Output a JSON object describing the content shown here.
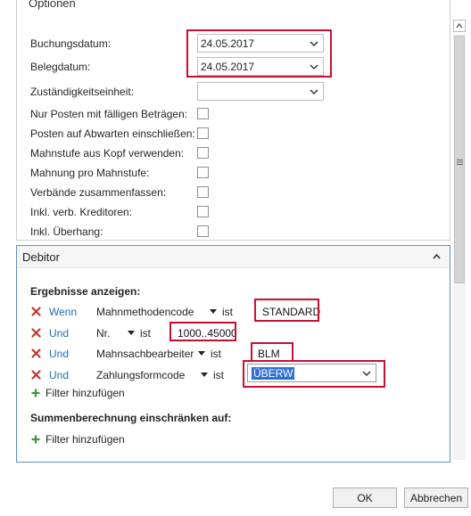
{
  "options": {
    "title": "Optionen",
    "posting_date": {
      "label": "Buchungsdatum:",
      "value": "24.05.2017"
    },
    "document_date": {
      "label": "Belegdatum:",
      "value": "24.05.2017"
    },
    "responsibility_center": {
      "label": "Zuständigkeitseinheit:",
      "value": ""
    },
    "checkboxes": [
      {
        "label": "Nur Posten mit fälligen Beträgen:",
        "checked": false
      },
      {
        "label": "Posten auf Abwarten einschließen:",
        "checked": false
      },
      {
        "label": "Mahnstufe aus Kopf verwenden:",
        "checked": false
      },
      {
        "label": "Mahnung pro Mahnstufe:",
        "checked": false
      },
      {
        "label": "Verbände zusammenfassen:",
        "checked": false
      },
      {
        "label": "Inkl. verb. Kreditoren:",
        "checked": false
      },
      {
        "label": "Inkl. Überhang:",
        "checked": false
      }
    ]
  },
  "debitor": {
    "title": "Debitor",
    "results_heading": "Ergebnisse anzeigen:",
    "filters": [
      {
        "connector": "Wenn",
        "field": "Mahnmethodencode",
        "operator": "ist",
        "value": "STANDARD"
      },
      {
        "connector": "Und",
        "field": "Nr.",
        "operator": "ist",
        "value": "1000..45000"
      },
      {
        "connector": "Und",
        "field": "Mahnsachbearbeiter",
        "operator": "ist",
        "value": "BLM"
      },
      {
        "connector": "Und",
        "field": "Zahlungsformcode",
        "operator": "ist",
        "value": "ÜBERW"
      }
    ],
    "add_filter_label": "Filter hinzufügen",
    "sum_heading": "Summenberechnung einschränken auf:",
    "sum_add_filter_label": "Filter hinzufügen"
  },
  "buttons": {
    "ok": "OK",
    "cancel": "Abbrechen"
  },
  "colors": {
    "highlight_border": "#c8102e",
    "link": "#1e6fb5",
    "remove_icon": "#c0392b",
    "add_icon": "#3a9a3a",
    "selection": "#2f6fd6"
  },
  "icons": [
    "chevron-down-icon",
    "remove-icon",
    "caret-down-icon",
    "add-icon",
    "collapse-icon",
    "scroll-up-icon",
    "scroll-down-icon"
  ]
}
